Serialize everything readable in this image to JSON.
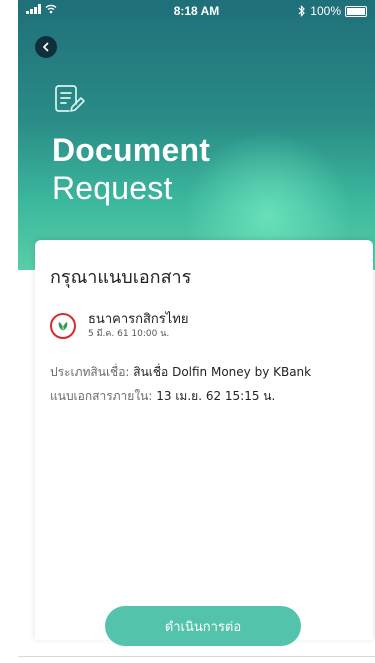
{
  "status_bar": {
    "time": "8:18 AM",
    "battery": "100%",
    "bluetooth_icon": "bluetooth-icon",
    "signal_icon": "signal-icon",
    "wifi_icon": "wifi-icon",
    "battery_icon": "battery-icon"
  },
  "header": {
    "back_icon": "chevron-left-icon",
    "doc_icon": "document-edit-icon",
    "title_bold": "Document",
    "title_light": "Request"
  },
  "card": {
    "heading": "กรุณาแนบเอกสาร",
    "bank": {
      "name": "ธนาคารกสิกรไทย",
      "date": "5 มี.ค. 61  10:00 น.",
      "logo_icon": "kbank-logo-icon"
    },
    "loan_type_label": "ประเภทสินเชื่อ:",
    "loan_type_value": "สินเชื่อ Dolfin Money by KBank",
    "attach_within_label": "แนบเอกสารภายใน:",
    "attach_within_value": "13 เม.ย. 62  15:15 น."
  },
  "actions": {
    "continue_label": "ดำเนินการต่อ"
  },
  "colors": {
    "header_gradient_top": "#1f6f78",
    "header_gradient_bottom": "#59cda8",
    "accent_button": "#54c3ac",
    "logo_red": "#d92b2b",
    "logo_green": "#2e9d4d"
  }
}
